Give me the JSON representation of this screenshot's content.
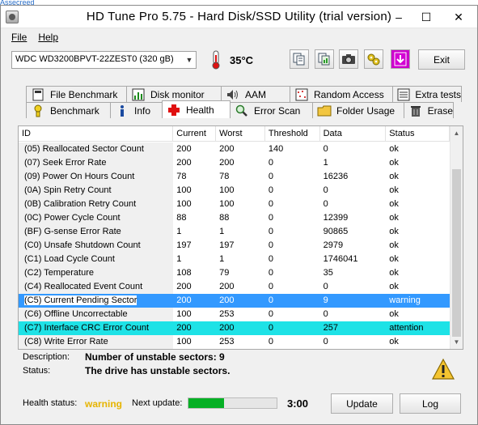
{
  "cropped_top_text": "Assecreed",
  "window": {
    "title": "HD Tune Pro 5.75 - Hard Disk/SSD Utility (trial version)",
    "minimize": "–",
    "maximize": "☐",
    "close": "✕"
  },
  "menu": {
    "file": "File",
    "help": "Help"
  },
  "toolbar": {
    "drive": "WDC WD3200BPVT-22ZEST0 (320 gB)",
    "temperature": "35°C",
    "exit_label": "Exit"
  },
  "tabs_top": [
    {
      "label": "File Benchmark",
      "icon": "file-benchmark-icon"
    },
    {
      "label": "Disk monitor",
      "icon": "disk-monitor-icon"
    },
    {
      "label": "AAM",
      "icon": "speaker-icon"
    },
    {
      "label": "Random Access",
      "icon": "random-access-icon"
    },
    {
      "label": "Extra tests",
      "icon": "extra-tests-icon"
    }
  ],
  "tabs_bottom": [
    {
      "label": "Benchmark",
      "icon": "benchmark-icon"
    },
    {
      "label": "Info",
      "icon": "info-icon"
    },
    {
      "label": "Health",
      "icon": "health-cross-icon",
      "active": true
    },
    {
      "label": "Error Scan",
      "icon": "magnifier-icon"
    },
    {
      "label": "Folder Usage",
      "icon": "folder-icon"
    },
    {
      "label": "Erase",
      "icon": "trash-icon"
    }
  ],
  "table": {
    "columns": [
      "ID",
      "Current",
      "Worst",
      "Threshold",
      "Data",
      "Status"
    ],
    "rows": [
      [
        "(05) Reallocated Sector Count",
        "200",
        "200",
        "140",
        "0",
        "ok"
      ],
      [
        "(07) Seek Error Rate",
        "200",
        "200",
        "0",
        "1",
        "ok"
      ],
      [
        "(09) Power On Hours Count",
        "78",
        "78",
        "0",
        "16236",
        "ok"
      ],
      [
        "(0A) Spin Retry Count",
        "100",
        "100",
        "0",
        "0",
        "ok"
      ],
      [
        "(0B) Calibration Retry Count",
        "100",
        "100",
        "0",
        "0",
        "ok"
      ],
      [
        "(0C) Power Cycle Count",
        "88",
        "88",
        "0",
        "12399",
        "ok"
      ],
      [
        "(BF) G-sense Error Rate",
        "1",
        "1",
        "0",
        "90865",
        "ok"
      ],
      [
        "(C0) Unsafe Shutdown Count",
        "197",
        "197",
        "0",
        "2979",
        "ok"
      ],
      [
        "(C1) Load Cycle Count",
        "1",
        "1",
        "0",
        "1746041",
        "ok"
      ],
      [
        "(C2) Temperature",
        "108",
        "79",
        "0",
        "35",
        "ok"
      ],
      [
        "(C4) Reallocated Event Count",
        "200",
        "200",
        "0",
        "0",
        "ok"
      ],
      [
        "(C5) Current Pending Sector",
        "200",
        "200",
        "0",
        "9",
        "warning"
      ],
      [
        "(C6) Offline Uncorrectable",
        "100",
        "253",
        "0",
        "0",
        "ok"
      ],
      [
        "(C7) Interface CRC Error Count",
        "200",
        "200",
        "0",
        "257",
        "attention"
      ],
      [
        "(C8) Write Error Rate",
        "100",
        "253",
        "0",
        "0",
        "ok"
      ]
    ],
    "selected_row": 11,
    "highlight_row": 13
  },
  "description": {
    "label": "Description:",
    "value": "Number of unstable sectors: 9",
    "status_label": "Status:",
    "status_value": "The drive has unstable sectors."
  },
  "footer": {
    "health_label": "Health status:",
    "health_value": "warning",
    "next_label": "Next update:",
    "progress_fraction": 0.4,
    "countdown": "3:00",
    "update_label": "Update",
    "log_label": "Log"
  },
  "colors": {
    "selected_row": "#3399ff",
    "attention_row": "#1ee2e6",
    "warning_text": "#e6b400",
    "progress": "#06b025"
  }
}
